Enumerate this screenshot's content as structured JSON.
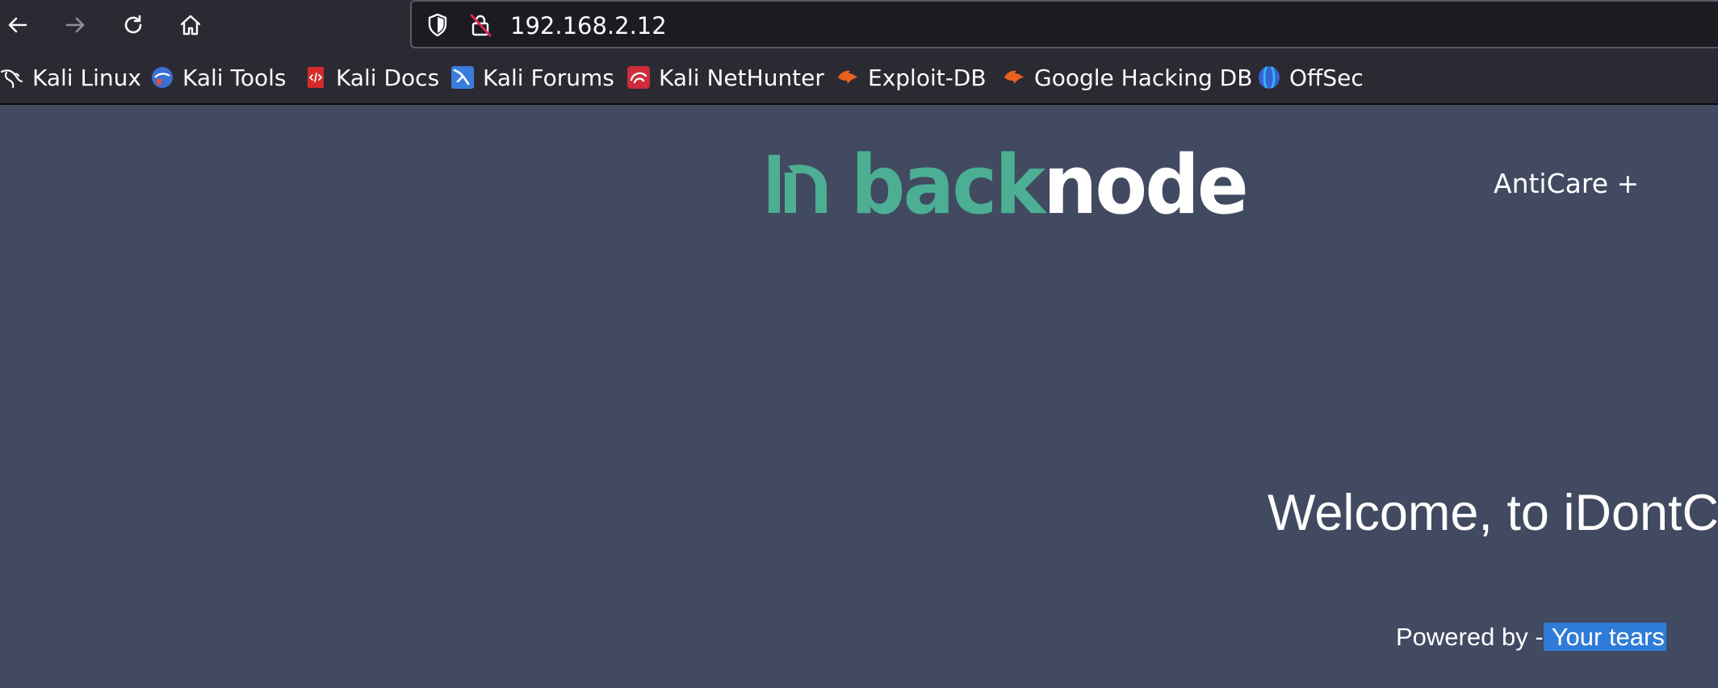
{
  "browser": {
    "url": "192.168.2.12",
    "icons": {
      "back": "arrow-left-icon",
      "forward": "arrow-right-icon",
      "reload": "reload-icon",
      "home": "home-icon",
      "tracking": "shield-icon",
      "insecure": "insecure-lock-icon"
    },
    "bookmarks": [
      {
        "label": "Kali Linux",
        "icon": "kali-dragon-icon"
      },
      {
        "label": "Kali Tools",
        "icon": "kali-tools-icon"
      },
      {
        "label": "Kali Docs",
        "icon": "kali-docs-icon"
      },
      {
        "label": "Kali Forums",
        "icon": "kali-forums-icon"
      },
      {
        "label": "Kali NetHunter",
        "icon": "nethunter-icon"
      },
      {
        "label": "Exploit-DB",
        "icon": "exploit-db-icon"
      },
      {
        "label": "Google Hacking DB",
        "icon": "ghdb-icon"
      },
      {
        "label": "OffSec",
        "icon": "offsec-icon"
      }
    ]
  },
  "page": {
    "logo": {
      "part1": "back",
      "part2": "node",
      "accent": "#4caf93",
      "text": "#ffffff"
    },
    "nav_link": "AntiCare +",
    "welcome": "Welcome, to iDontC",
    "powered_prefix": "Powered by -",
    "powered_selected": " Your tears",
    "colors": {
      "background": "#414a60",
      "selection": "#2f7bd8"
    }
  }
}
